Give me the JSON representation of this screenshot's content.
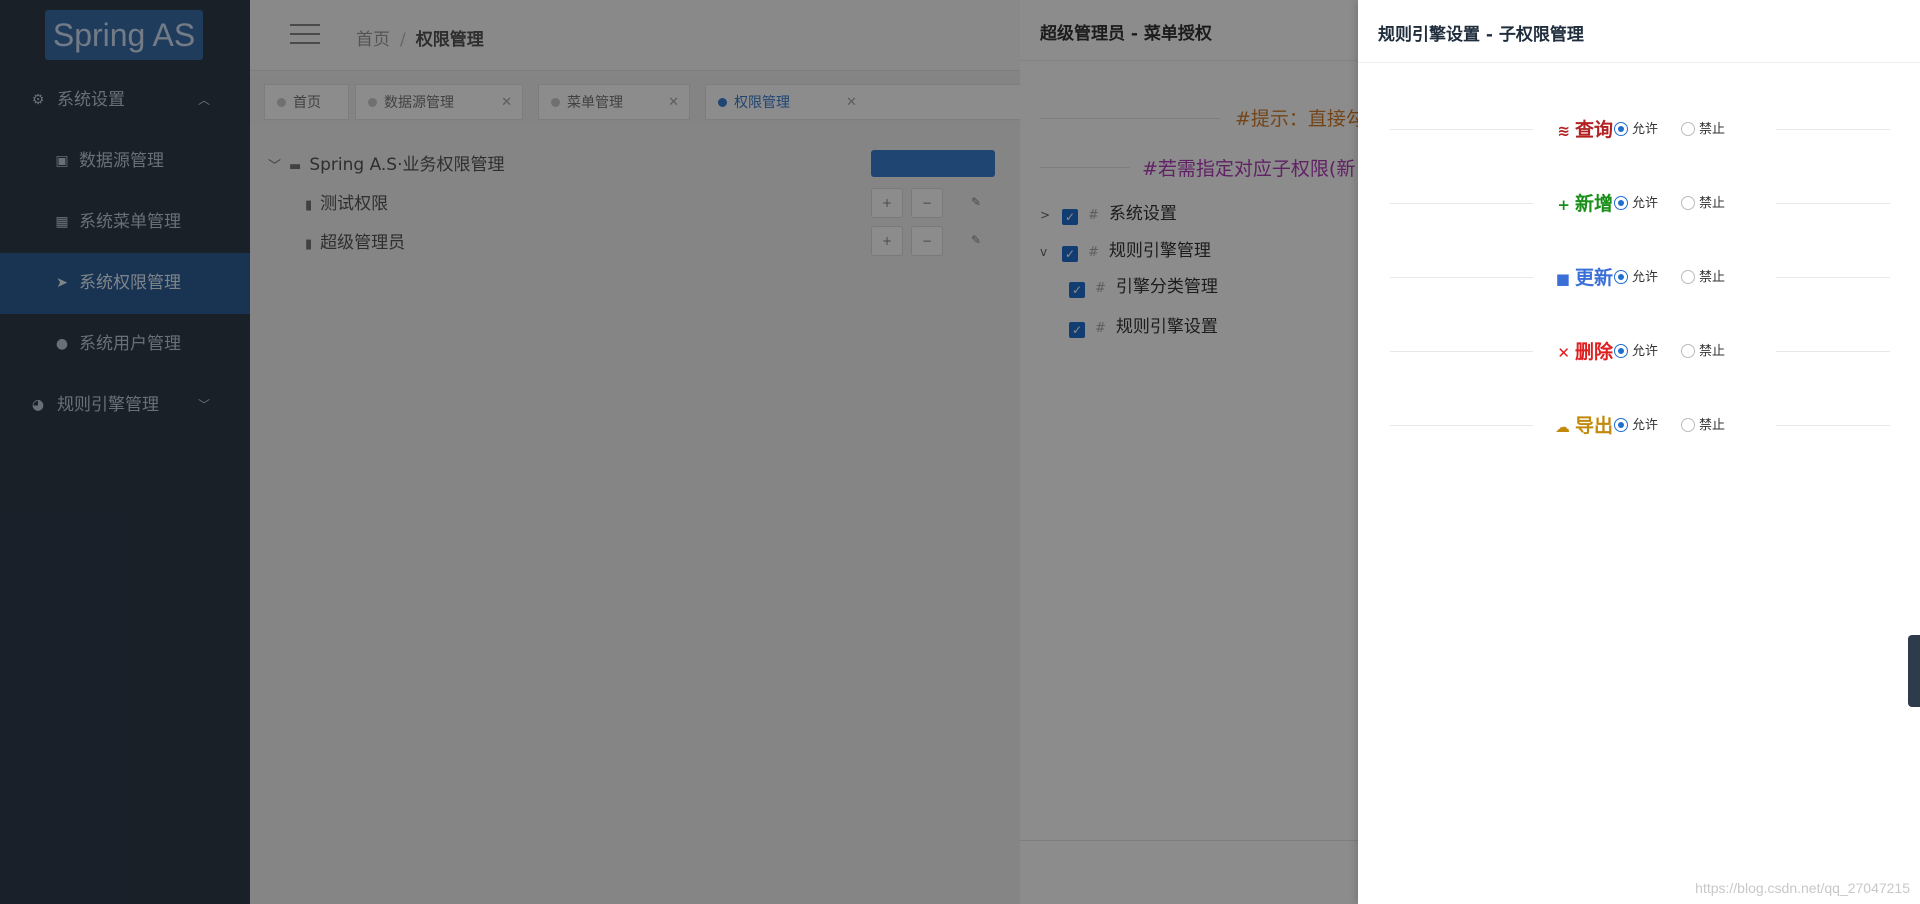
{
  "app": {
    "logo": "Spring AS"
  },
  "sidebar": {
    "items": [
      {
        "label": "系统设置",
        "icon": "gear-icon"
      },
      {
        "label": "数据源管理",
        "icon": "database-icon"
      },
      {
        "label": "系统菜单管理",
        "icon": "windows-icon"
      },
      {
        "label": "系统权限管理",
        "icon": "send-icon"
      },
      {
        "label": "系统用户管理",
        "icon": "user-icon"
      },
      {
        "label": "规则引擎管理",
        "icon": "pie-icon"
      }
    ]
  },
  "header": {
    "breadcrumb": [
      "首页",
      "权限管理"
    ]
  },
  "tabs": [
    {
      "label": "首页"
    },
    {
      "label": "数据源管理"
    },
    {
      "label": "菜单管理"
    },
    {
      "label": "权限管理"
    }
  ],
  "tree": {
    "root": "Spring A.S·业务权限管理",
    "children": [
      "测试权限",
      "超级管理员"
    ]
  },
  "drawer_menu": {
    "title": "超级管理员 - 菜单授权",
    "tip1": "#提示：直接勾",
    "tip2": "#若需指定对应子权限(新",
    "nodes": [
      "系统设置",
      "规则引擎管理",
      "引擎分类管理",
      "规则引擎设置"
    ]
  },
  "drawer_perm": {
    "title": "规则引擎设置 - 子权限管理",
    "allow_label": "允许",
    "deny_label": "禁止",
    "permissions": [
      {
        "label": "查询",
        "icon": "layers-icon",
        "color": "#b22222",
        "allowed": true
      },
      {
        "label": "新增",
        "icon": "plus-icon",
        "color": "#1a8f1a",
        "allowed": true
      },
      {
        "label": "更新",
        "icon": "copy-icon",
        "color": "#3b6fd8",
        "allowed": true
      },
      {
        "label": "删除",
        "icon": "close-icon",
        "color": "#e02020",
        "allowed": true
      },
      {
        "label": "导出",
        "icon": "cloud-download-icon",
        "color": "#c28a0c",
        "allowed": true
      }
    ]
  },
  "watermark": "https://blog.csdn.net/qq_27047215"
}
